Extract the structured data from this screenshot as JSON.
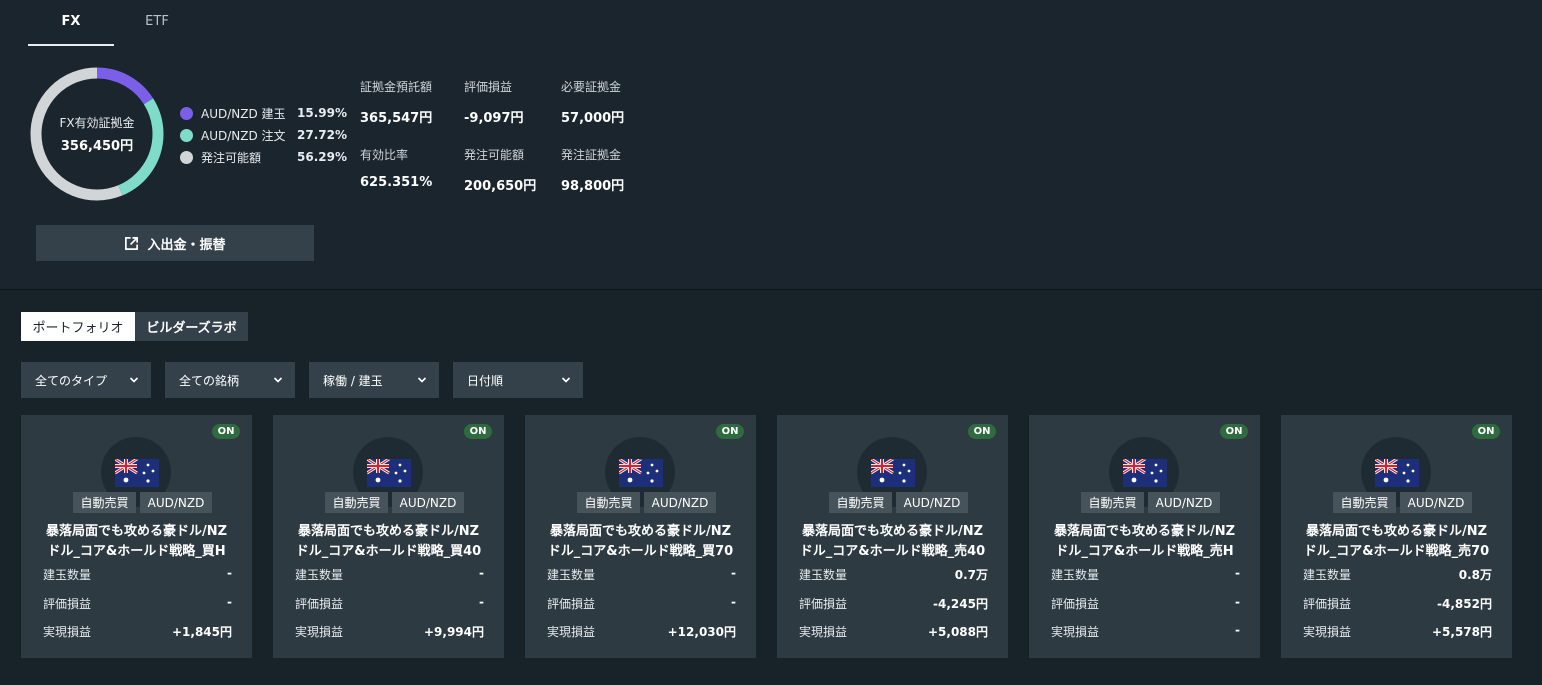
{
  "tabs": {
    "fx": "FX",
    "etf": "ETF"
  },
  "donut": {
    "label": "FX有効証拠金",
    "value": "356,450円",
    "segments": [
      {
        "name": "AUD/NZD 建玉",
        "pct_text": "15.99%",
        "fraction": 0.1599,
        "color": "#7b5fe9"
      },
      {
        "name": "AUD/NZD 注文",
        "pct_text": "27.72%",
        "fraction": 0.2772,
        "color": "#7fdcc8"
      },
      {
        "name": "発注可能額",
        "pct_text": "56.29%",
        "fraction": 0.5629,
        "color": "#d2d5d7"
      }
    ]
  },
  "stats": [
    {
      "label": "証拠金預託額",
      "value": "365,547円"
    },
    {
      "label": "評価損益",
      "value": "-9,097円"
    },
    {
      "label": "必要証拠金",
      "value": "57,000円"
    },
    {
      "label": "有効比率",
      "value": "625.351%"
    },
    {
      "label": "発注可能額",
      "value": "200,650円"
    },
    {
      "label": "発注証拠金",
      "value": "98,800円"
    }
  ],
  "deposit_button": "入出金・振替",
  "subtabs": {
    "portfolio": "ポートフォリオ",
    "builders": "ビルダーズラボ"
  },
  "filters": [
    "全てのタイプ",
    "全ての銘柄",
    "稼働 / 建玉",
    "日付順"
  ],
  "cards": [
    {
      "status": "ON",
      "tag_type": "自動売買",
      "tag_pair": "AUD/NZD",
      "title_line1": "暴落局面でも攻める豪ドル/NZ",
      "title_line2": "ドル_コア&ホールド戦略_買H",
      "rows": [
        {
          "label": "建玉数量",
          "value": "-"
        },
        {
          "label": "評価損益",
          "value": "-"
        },
        {
          "label": "実現損益",
          "value": "+1,845円"
        }
      ]
    },
    {
      "status": "ON",
      "tag_type": "自動売買",
      "tag_pair": "AUD/NZD",
      "title_line1": "暴落局面でも攻める豪ドル/NZ",
      "title_line2": "ドル_コア&ホールド戦略_買40",
      "rows": [
        {
          "label": "建玉数量",
          "value": "-"
        },
        {
          "label": "評価損益",
          "value": "-"
        },
        {
          "label": "実現損益",
          "value": "+9,994円"
        }
      ]
    },
    {
      "status": "ON",
      "tag_type": "自動売買",
      "tag_pair": "AUD/NZD",
      "title_line1": "暴落局面でも攻める豪ドル/NZ",
      "title_line2": "ドル_コア&ホールド戦略_買70",
      "rows": [
        {
          "label": "建玉数量",
          "value": "-"
        },
        {
          "label": "評価損益",
          "value": "-"
        },
        {
          "label": "実現損益",
          "value": "+12,030円"
        }
      ]
    },
    {
      "status": "ON",
      "tag_type": "自動売買",
      "tag_pair": "AUD/NZD",
      "title_line1": "暴落局面でも攻める豪ドル/NZ",
      "title_line2": "ドル_コア&ホールド戦略_売40",
      "rows": [
        {
          "label": "建玉数量",
          "value": "0.7万"
        },
        {
          "label": "評価損益",
          "value": "-4,245円"
        },
        {
          "label": "実現損益",
          "value": "+5,088円"
        }
      ]
    },
    {
      "status": "ON",
      "tag_type": "自動売買",
      "tag_pair": "AUD/NZD",
      "title_line1": "暴落局面でも攻める豪ドル/NZ",
      "title_line2": "ドル_コア&ホールド戦略_売H",
      "rows": [
        {
          "label": "建玉数量",
          "value": "-"
        },
        {
          "label": "評価損益",
          "value": "-"
        },
        {
          "label": "実現損益",
          "value": "-"
        }
      ]
    },
    {
      "status": "ON",
      "tag_type": "自動売買",
      "tag_pair": "AUD/NZD",
      "title_line1": "暴落局面でも攻める豪ドル/NZ",
      "title_line2": "ドル_コア&ホールド戦略_売70",
      "rows": [
        {
          "label": "建玉数量",
          "value": "0.8万"
        },
        {
          "label": "評価損益",
          "value": "-4,852円"
        },
        {
          "label": "実現損益",
          "value": "+5,578円"
        }
      ]
    }
  ]
}
